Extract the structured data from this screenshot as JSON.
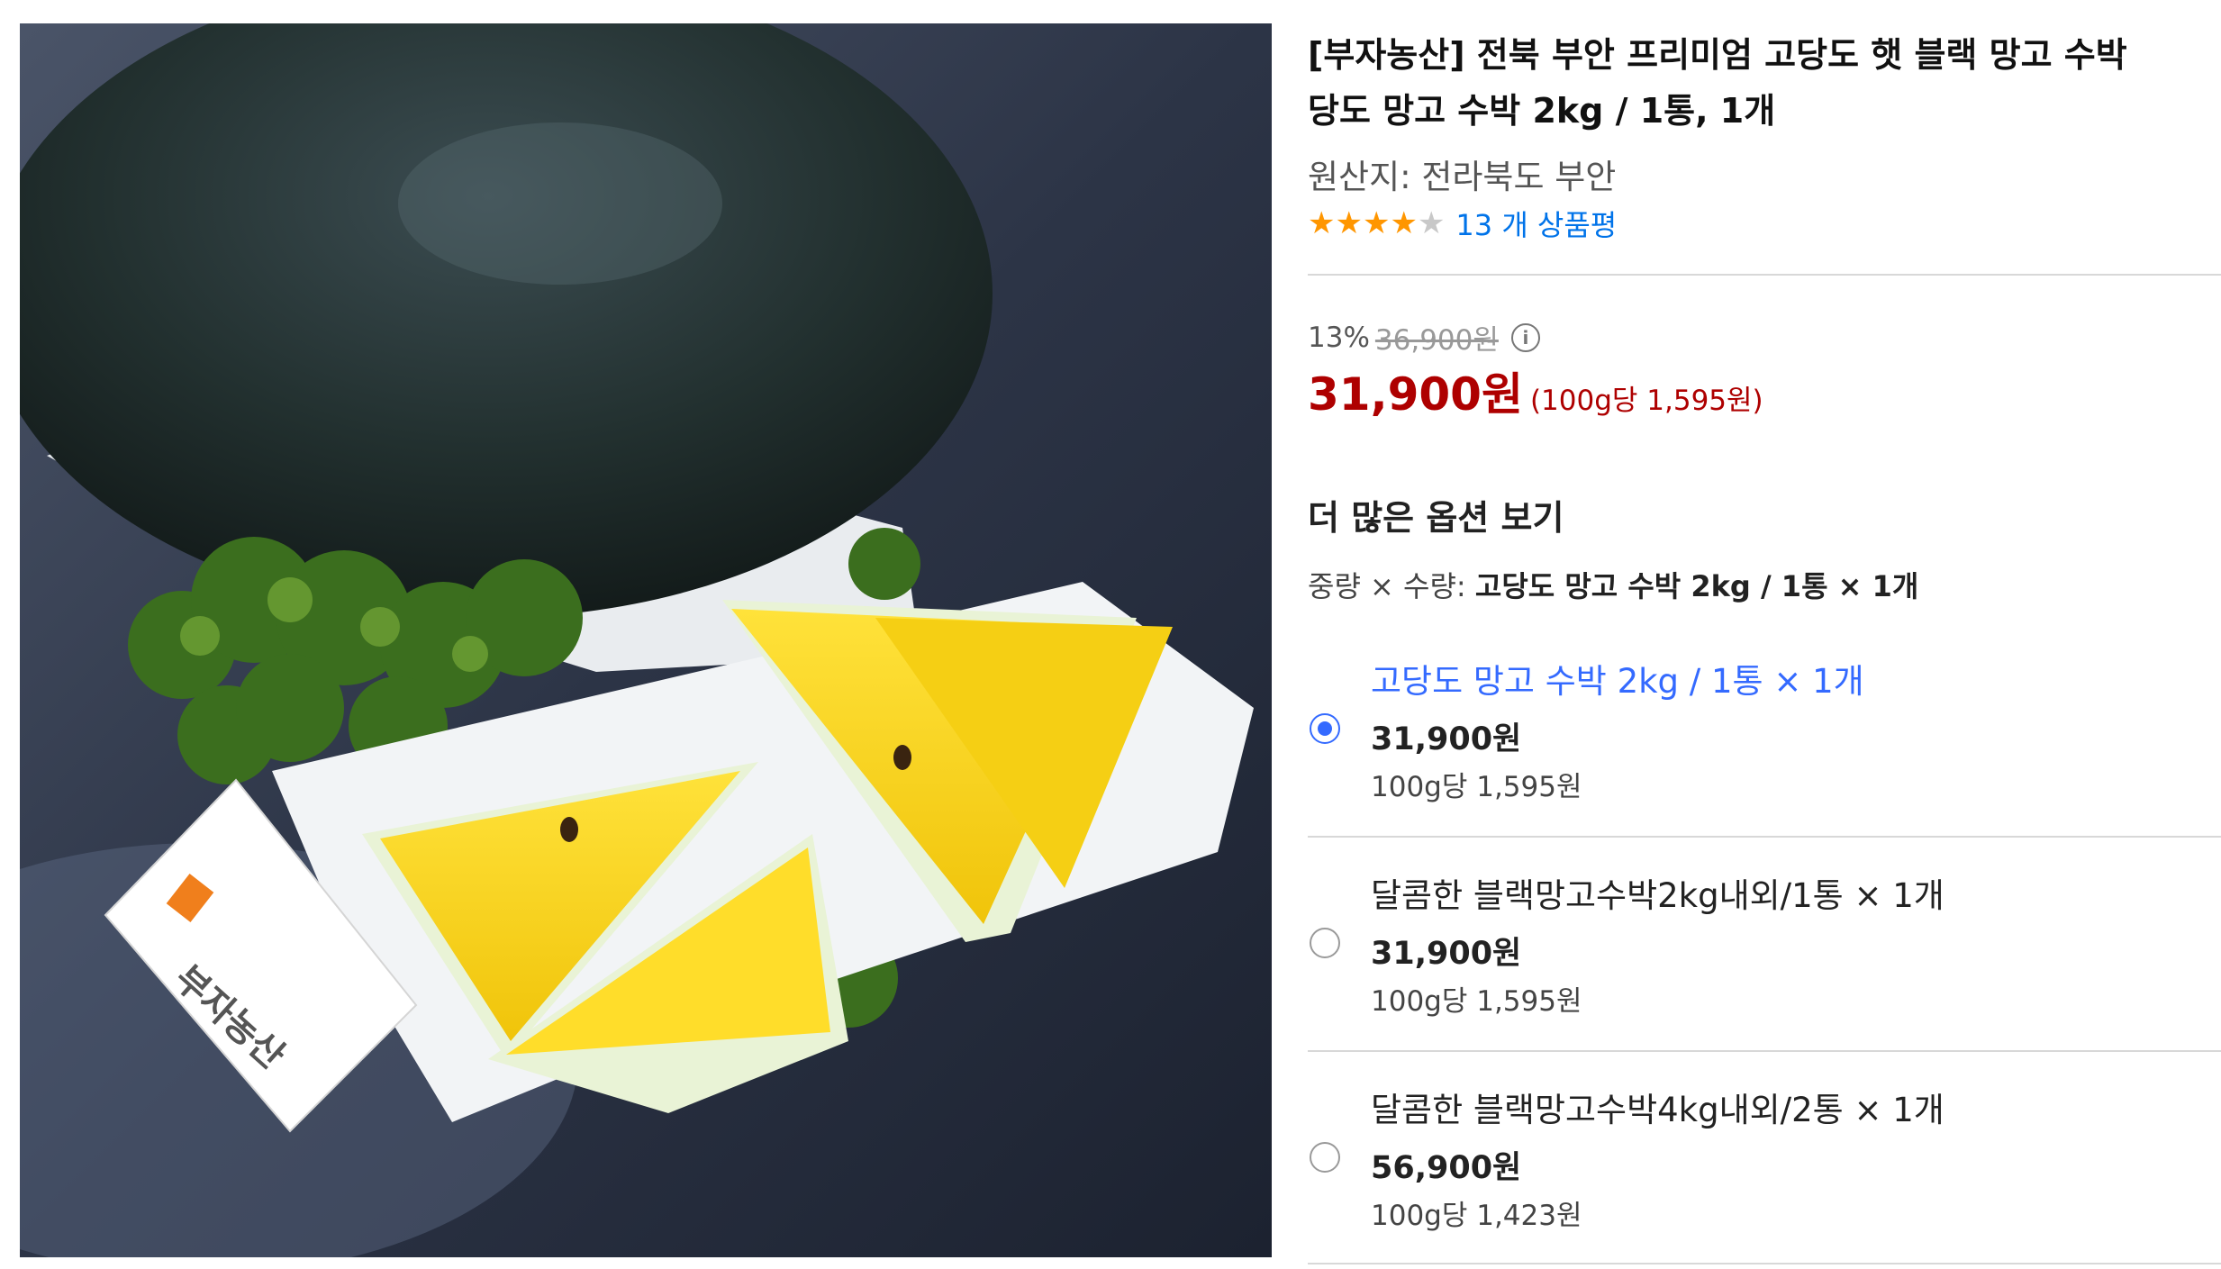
{
  "product": {
    "title_line1": "[부자농산] 전북 부안 프리미엄 고당도 햇 블랙 망고 수박",
    "title_line2": "당도 망고 수박 2kg / 1통, 1개",
    "origin": "원산지: 전라북도 부안",
    "rating": {
      "stars_filled": 4,
      "stars_total": 5,
      "review_text": "13 개 상품평"
    },
    "image_logo_text": "부자농산"
  },
  "pricing": {
    "discount_rate": "13%",
    "original_price": "36,900원",
    "info_icon": "info-circle-icon",
    "sale_price": "31,900원",
    "unit_price": "(100g당 1,595원)"
  },
  "options": {
    "heading": "더 많은 옵션 보기",
    "selected_label": "중량 × 수량: ",
    "selected_value": "고당도 망고 수박 2kg / 1통 × 1개",
    "items": [
      {
        "name": "고당도 망고 수박 2kg / 1통 × 1개",
        "price": "31,900원",
        "unit": "100g당 1,595원",
        "selected": true
      },
      {
        "name": "달콤한 블랙망고수박2kg내외/1통 × 1개",
        "price": "31,900원",
        "unit": "100g당 1,595원",
        "selected": false
      },
      {
        "name": "달콤한 블랙망고수박4kg내외/2통 × 1개",
        "price": "56,900원",
        "unit": "100g당 1,423원",
        "selected": false
      }
    ]
  },
  "colors": {
    "sale_red": "#ae0000",
    "link_blue": "#0073e9",
    "select_blue": "#346aff",
    "star_orange": "#ff9600"
  }
}
